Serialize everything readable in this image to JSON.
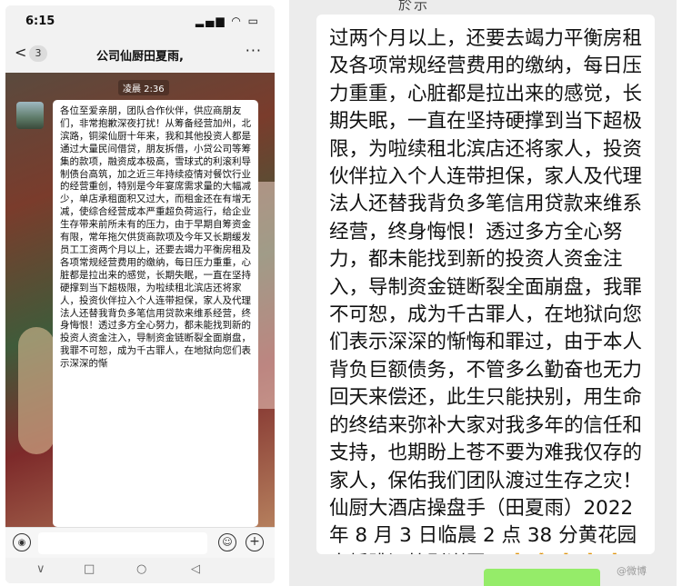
{
  "left": {
    "status": {
      "time": "6:15",
      "icons": "▂▄▆ ◠ ▭"
    },
    "nav": {
      "back": "<",
      "unread": "3",
      "title": "公司仙厨田夏雨,",
      "more": "···"
    },
    "timestamp": "凌晨 2:36",
    "message": "各位至爱亲朋，团队合作伙伴，供应商朋友们，非常抱歉深夜打扰！从筹备经营加州，北滨路，铜梁仙厨十年来，我和其他投资人都是通过大量民间借贷，朋友拆借，小贷公司等筹集的款项，融资成本极高，雪球式的利滚利导制债台高筑，加之近三年持续疫情对餐饮行业的经营重创，特别是今年宴席需求量的大幅减少，单店承租面积又过大，而租金还在有增无减，使综合经营成本严重超负荷运行，给企业生存带来前所未有的压力，由于早期自筹资金有限，常年拖欠供货商款项及今年又长期缓发员工工资两个月以上，还要去竭力平衡房租及各项常规经营费用的缴纳，每日压力重重，心脏都是拉出来的感觉，长期失眠，一直在坚持硬撑到当下超极限，为啦续租北滨店还将家人，投资伙伴拉入个人连带担保，家人及代理法人还替我背负多笔信用贷款来维系经营，终身悔恨！透过多方全心努力，都未能找到新的投资人资金注入，导制资金链断裂全面崩盘，我罪不可恕，成为千古罪人，在地狱向您们表示深深的惭",
    "input_bar": {
      "voice": "◉",
      "emoji": "☺",
      "plus": "+"
    },
    "sys_nav": {
      "down": "∨",
      "square": "□",
      "circle": "○",
      "back": "◁"
    }
  },
  "right": {
    "top_cut": "於示",
    "message": "过两个月以上，还要去竭力平衡房租及各项常规经营费用的缴纳，每日压力重重，心脏都是拉出来的感觉，长期失眠，一直在坚持硬撑到当下超极限，为啦续租北滨店还将家人，投资伙伴拉入个人连带担保，家人及代理法人还替我背负多笔信用贷款来维系经营，终身悔恨！透过多方全心努力，都未能找到新的投资人资金注入，导制资金链断裂全面崩盘，我罪不可恕，成为千古罪人，在地狱向您们表示深深的惭悔和罪过，由于本人背负巨额债务，不管多么勤奋也无力回天来偿还，此生只能抉别，用生命的终结来弥补大家对我多年的信任和支持，也期盼上苍不要为难我仅存的家人，保佑我们团队渡过生存之灾！仙厨大酒店操盘手（田夏雨）2022 年 8 月 3 日临晨 2 点 38 分黄花园大桥跳江抉别谢罪！🙏🙏🙏🙏🙏🙏🙏🙏🙏🙏",
    "watermark": "@微博"
  }
}
